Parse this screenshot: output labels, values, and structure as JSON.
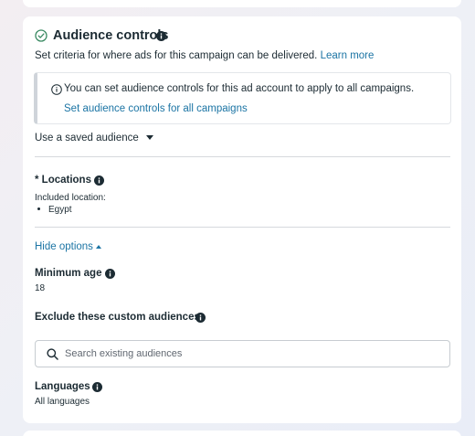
{
  "section": {
    "title": "Audience controls",
    "description": "Set criteria for where ads for this campaign can be delivered.",
    "learn_more": "Learn more"
  },
  "notice": {
    "text": "You can set audience controls for this ad account to apply to all campaigns.",
    "link": "Set audience controls for all campaigns"
  },
  "saved_audience": {
    "label": "Use a saved audience"
  },
  "locations": {
    "label": "* Locations",
    "included_label": "Included location:",
    "items": [
      "Egypt"
    ]
  },
  "options_toggle": {
    "label": "Hide options"
  },
  "minimum_age": {
    "label": "Minimum age",
    "value": "18"
  },
  "exclude_audiences": {
    "label": "Exclude these custom audiences",
    "search_placeholder": "Search existing audiences",
    "search_value": ""
  },
  "languages": {
    "label": "Languages",
    "value": "All languages"
  },
  "colors": {
    "accent_link": "#1b74a4",
    "check_green": "#3a8a62",
    "text": "#1c2b33"
  },
  "icons": {
    "section_status": "check-circle-icon",
    "info": "info-icon",
    "notice": "info-outline-icon",
    "search": "search-icon"
  }
}
